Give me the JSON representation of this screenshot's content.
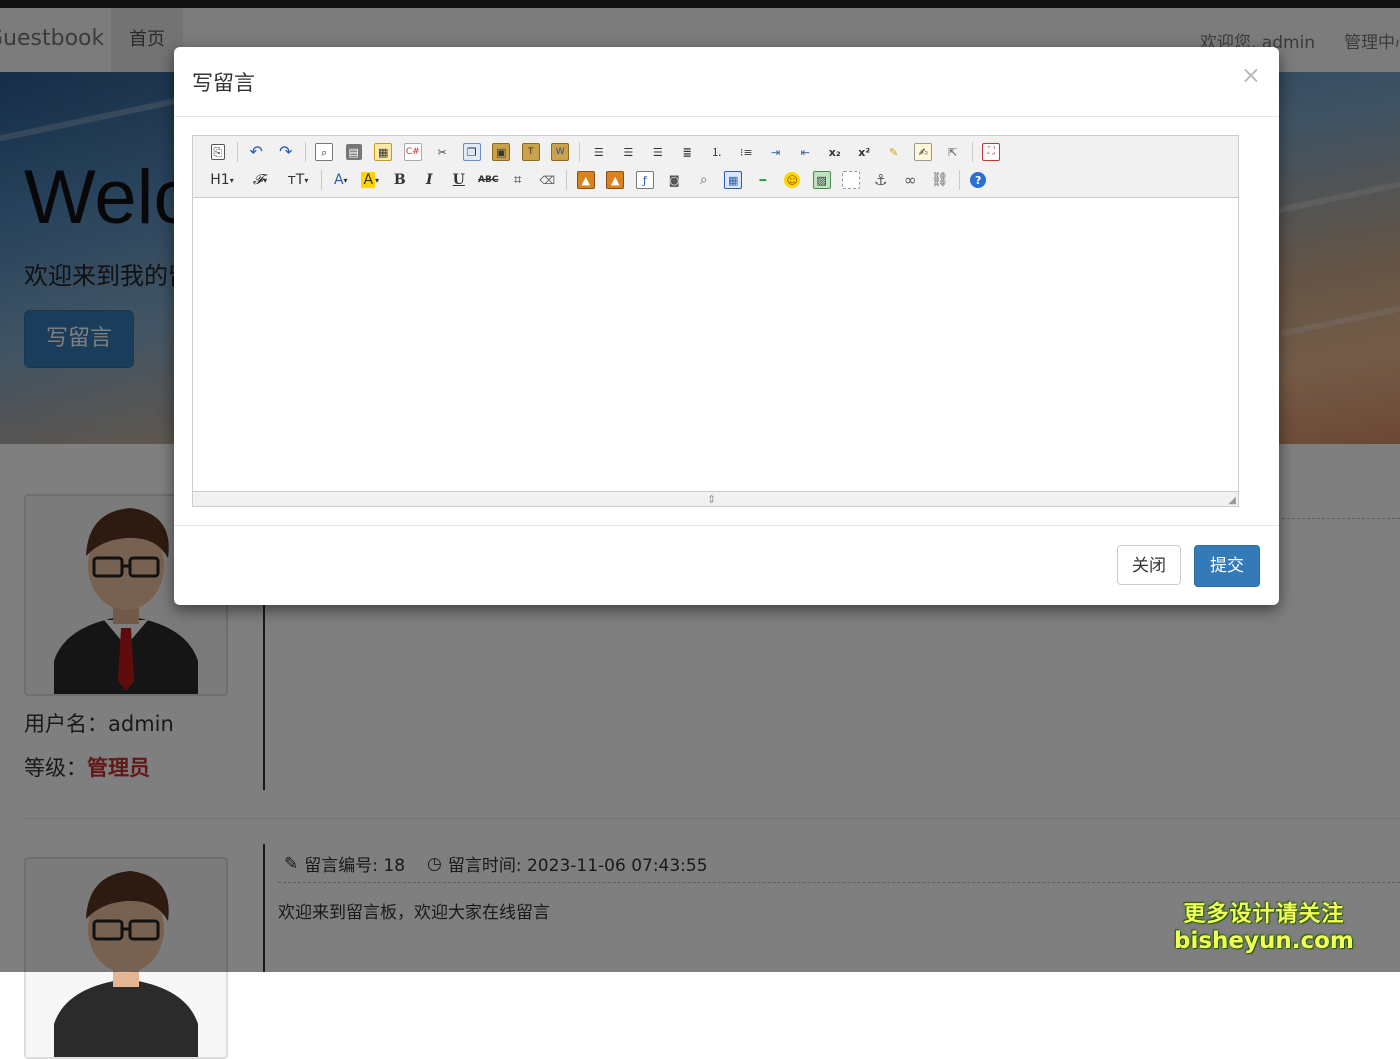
{
  "navbar": {
    "brand": "Guestbook",
    "home": "首页",
    "welcome": "欢迎您, admin",
    "admin_center": "管理中心"
  },
  "hero": {
    "title": "Welcome",
    "subtitle": "欢迎来到我的留言板",
    "write_button": "写留言"
  },
  "users": [
    {
      "name_label": "用户名：",
      "name": "admin",
      "level_label": "等级：",
      "level": "管理员"
    }
  ],
  "message": {
    "id_label": "留言编号: 18",
    "time_label": "留言时间: 2023-11-06 07:43:55",
    "content": "欢迎来到留言板，欢迎大家在线留言"
  },
  "modal": {
    "title": "写留言",
    "close_icon": "×",
    "close_button": "关闭",
    "submit_button": "提交"
  },
  "toolbar": {
    "row1": [
      "source-icon",
      "|",
      "undo-icon",
      "redo-icon",
      "|",
      "preview-icon",
      "print-icon",
      "template-icon",
      "code-icon",
      "cut-icon",
      "copy-icon",
      "paste-icon",
      "paste-text-icon",
      "paste-word-icon",
      "|",
      "align-left-icon",
      "align-center-icon",
      "align-right-icon",
      "align-justify-icon",
      "ordered-list-icon",
      "unordered-list-icon",
      "indent-icon",
      "outdent-icon",
      "subscript-icon",
      "superscript-icon",
      "clear-format-icon",
      "select-all-icon",
      "quick-format-icon",
      "|",
      "fullscreen-icon"
    ],
    "row2_labels": {
      "heading": "H1",
      "font": "𝓕",
      "size": "тT",
      "fontcolor": "A",
      "bg": "A",
      "bold": "B",
      "italic": "I",
      "underline": "U",
      "strike": "ABC",
      "line": "⌗"
    },
    "row2": [
      "heading-icon",
      "font-family-icon",
      "font-size-icon",
      "|",
      "font-color-icon",
      "highlight-icon",
      "bold-icon",
      "italic-icon",
      "underline-icon",
      "strikethrough-icon",
      "line-height-icon",
      "remove-format-icon",
      "|",
      "image-icon",
      "multi-image-icon",
      "flash-icon",
      "media-icon",
      "attachment-icon",
      "table-icon",
      "horizontal-rule-icon",
      "emoticon-icon",
      "map-icon",
      "page-break-icon",
      "anchor-icon",
      "link-icon",
      "unlink-icon",
      "|",
      "help-icon"
    ]
  },
  "watermark": {
    "line1": "更多设计请关注",
    "line2": "bisheyun.com"
  }
}
